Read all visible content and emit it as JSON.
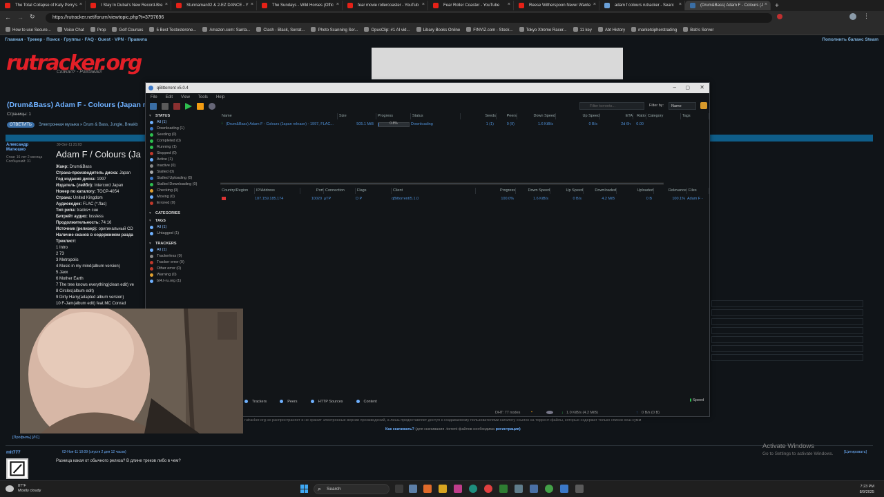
{
  "browser": {
    "tabs": [
      {
        "label": "The Total Collapse of Katy Perry's",
        "active": false
      },
      {
        "label": "I Stay In Dubai's New Record-Bre",
        "active": false
      },
      {
        "label": "Stunnaman02 & 2-EZ DANCE - Y",
        "active": false
      },
      {
        "label": "The Sundays - Wild Horses (Offic",
        "active": false
      },
      {
        "label": "fear movie rollercoaster - YouTub",
        "active": false
      },
      {
        "label": "Fear Roller Coaster - YouTube",
        "active": false
      },
      {
        "label": "Reese Witherspoon Never Wante",
        "active": false
      },
      {
        "label": "adam f colours rutracker - Searc",
        "active": false
      },
      {
        "label": "(Drum&Bass) Adam F - Colours (J",
        "active": true
      }
    ],
    "url": "https://rutracker.net/forum/viewtopic.php?t=3797696",
    "bookmarks": [
      "How to use Secure...",
      "Voice Chat",
      "Prop",
      "Golf Courses",
      "5 Best Testosterone...",
      "Amazon.com: Santa...",
      "Clash - Black, Serrat...",
      "Photo Scanning Ser...",
      "OpusClip: #1 AI vid...",
      "Libary Books Online",
      "FINVIZ.com - Stock...",
      "Tokyo Xtreme Racer...",
      "11 key",
      "Abt History",
      "marketcipherstrading",
      "Bob's Server"
    ]
  },
  "forum": {
    "topnav": "Главная · Трекер · Поиск · Группы · FAQ · Guest · VPN · Правила",
    "topright": "Пополнить баланс Steam",
    "logo": "rutracker.org",
    "logo_sub": "Скачал? - Раздавай!",
    "topic_title": "(Drum&Bass) Adam F - Colours (Japan r",
    "pages_label": "Страницы: 1",
    "category_pill": "ОТВЕТИТЬ",
    "category_path": "Электронная музыка » Drum & Bass, Jungle, Breakb",
    "author": "Александр Матюшко",
    "author_info": [
      "Стаж: 16 лет 2 месяца",
      "Сообщений: 31"
    ],
    "post_date": "30-Окт-11 21:03",
    "post_title": "Adam F / Colours (Ja",
    "details": [
      {
        "k": "Жанр:",
        "v": " Drum&Bass"
      },
      {
        "k": "Страна-производитель диска:",
        "v": " Japan"
      },
      {
        "k": "Год издания диска:",
        "v": " 1997"
      },
      {
        "k": "Издатель (лейбл):",
        "v": " Intercord Japan"
      },
      {
        "k": "Номер по каталогу:",
        "v": " TOCP-4054"
      },
      {
        "k": "Страна:",
        "v": " United Kingdom"
      },
      {
        "k": "Аудиокодек:",
        "v": " FLAC (*.flac)"
      },
      {
        "k": "Тип рипа:",
        "v": " tracks+.cue"
      },
      {
        "k": "Битрейт аудио:",
        "v": " lossless"
      },
      {
        "k": "Продолжительность:",
        "v": " 74:16"
      },
      {
        "k": "Источник (релизер):",
        "v": " оригинальный CD"
      },
      {
        "k": "Наличие сканов в содержимом разда",
        "v": ""
      },
      {
        "k": "Треклист:",
        "v": ""
      },
      {
        "k": "",
        "v": "1 Intro"
      },
      {
        "k": "",
        "v": "2 73"
      },
      {
        "k": "",
        "v": "3 Metropolis"
      },
      {
        "k": "",
        "v": "4 Music in my mind(album version)"
      },
      {
        "k": "",
        "v": "5 Jaxx"
      },
      {
        "k": "",
        "v": "6 Mother Earth"
      },
      {
        "k": "",
        "v": "7 The tree knows everything(clean edit) ve"
      },
      {
        "k": "",
        "v": "8 Circles(album edit)"
      },
      {
        "k": "",
        "v": "9 Dirty Harry(adapted album version)"
      },
      {
        "k": "",
        "v": "10 F-Jam(album edit) feat.MC Conrad"
      }
    ],
    "footer_line1": "rutracker.org не распространяет и не хранит электронные версии произведений, а лишь предоставляет доступ к создаваемому пользователями каталогу ссылок на торрент-файлы, которые содержат только списки хеш-сумм",
    "footer_q": "Как скачивать?",
    "footer_q2": "(для скачивания .torrent файлов необходима",
    "footer_link": "регистрация)",
    "profile_links": "[Профиль]  [ЛС]",
    "reply_author": "mlt777",
    "reply_date": "02-Ноя-11 10:09   (спустя 2 дня 12 часов)",
    "reply_cite": "[Цитировать]",
    "reply_text": "Разница какая от обычного релиза? В длине треков либо в чем?",
    "activate1": "Activate Windows",
    "activate2": "Go to Settings to activate Windows."
  },
  "qbt": {
    "title": "qBittorrent v5.0.4",
    "menu": [
      "File",
      "Edit",
      "View",
      "Tools",
      "Help"
    ],
    "filter_placeholder": "Filter torrents...",
    "filter_by_label": "Filter by:",
    "filter_by_value": "Name",
    "sidebar": {
      "status_header": "STATUS",
      "status": [
        "All (1)",
        "Downloading (1)",
        "Seeding (0)",
        "Completed (0)",
        "Running (1)",
        "Stopped (0)",
        "Active (1)",
        "Inactive (0)",
        "Stalled (0)",
        "Stalled Uploading (0)",
        "Stalled Downloading (0)",
        "Checking (0)",
        "Moving (0)",
        "Errored (0)"
      ],
      "categories_header": "CATEGORIES",
      "tags_header": "TAGS",
      "tags": [
        "All (1)",
        "Untagged (1)"
      ],
      "trackers_header": "TRACKERS",
      "trackers": [
        "All (1)",
        "Trackerless (0)",
        "Tracker error (0)",
        "Other error (0)",
        "Warning (0)",
        "bt4.t-ru.org (1)"
      ]
    },
    "columns": [
      "Name",
      "Size",
      "Progress",
      "Status",
      "Seeds",
      "Peers",
      "Down Speed",
      "Up Speed",
      "ETA",
      "Ratio",
      "Category",
      "Tags"
    ],
    "torrent": {
      "name": "(Drum&Bass) Adam F - Colours (Japan release) - 1997, FLAC...",
      "size": "505.1 MiB",
      "progress": "0.8%",
      "progress_value": 0.008,
      "status": "Downloading",
      "seeds": "1 (1)",
      "peers": "0 (9)",
      "down": "1.6 KiB/s",
      "up": "0 B/s",
      "eta": "2d 6h",
      "ratio": "0.00"
    },
    "peer_columns": [
      "Country/Region",
      "IP/Address",
      "Port",
      "Connection",
      "Flags",
      "Client",
      "Progress",
      "Down Speed",
      "Up Speed",
      "Downloaded",
      "Uploaded",
      "Relevance",
      "Files"
    ],
    "peer": {
      "ip": "107.159.185.174",
      "port": "10020",
      "conn": "μTP",
      "flags": "D P",
      "client": "qBittorrent/5.1.0",
      "progress": "100.0%",
      "down": "1.6 KiB/s",
      "up": "0 B/s",
      "downloaded": "4.2 MiB",
      "uploaded": "0 B",
      "relevance": "100.1%",
      "files": "Adam F -"
    },
    "tabs": [
      "Trackers",
      "Peers",
      "HTTP Sources",
      "Content"
    ],
    "speed_btn": "Speed",
    "status_dht": "DHT: 77 nodes",
    "status_down": "1.0 KiB/s (4.2 MiB)",
    "status_up": "0 B/s (0 B)"
  },
  "taskbar": {
    "weather_temp": "87°F",
    "weather_desc": "Mostly cloudy",
    "search": "Search",
    "time": "7:23 PM",
    "date": "8/9/2025"
  },
  "colors": {
    "accent": "#6fb1ff",
    "rutracker_red": "#e21f27",
    "play_green": "#2ec04f",
    "stop_orange": "#f39c12"
  }
}
